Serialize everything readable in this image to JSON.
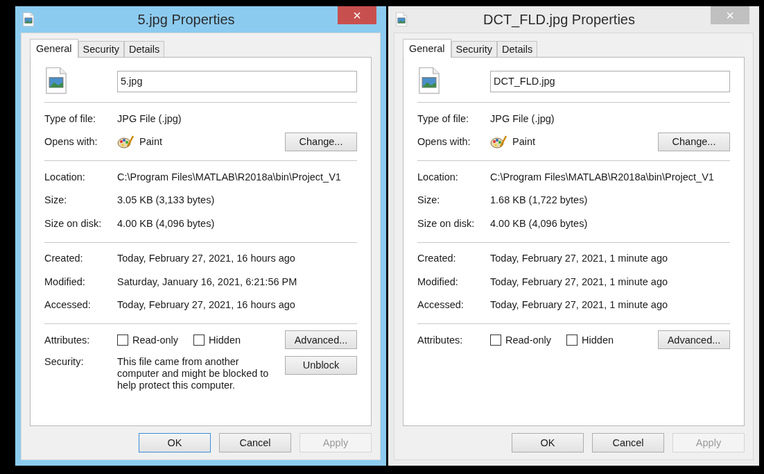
{
  "dialogs": [
    {
      "title": "5.jpg Properties",
      "active": true,
      "close": "×",
      "tabs": [
        {
          "label": "General",
          "selected": true
        },
        {
          "label": "Security",
          "selected": false
        },
        {
          "label": "Details",
          "selected": false
        }
      ],
      "filename": "5.jpg",
      "groups": [
        [
          {
            "kind": "text",
            "label": "Type of file:",
            "value": "JPG File (.jpg)"
          },
          {
            "kind": "app",
            "label": "Opens with:",
            "value": "Paint",
            "button": "Change..."
          }
        ],
        [
          {
            "kind": "text",
            "label": "Location:",
            "value": "C:\\Program Files\\MATLAB\\R2018a\\bin\\Project_V1"
          },
          {
            "kind": "text",
            "label": "Size:",
            "value": "3.05 KB (3,133 bytes)"
          },
          {
            "kind": "text",
            "label": "Size on disk:",
            "value": "4.00 KB (4,096 bytes)"
          }
        ],
        [
          {
            "kind": "text",
            "label": "Created:",
            "value": "Today, February 27, 2021, 16 hours ago"
          },
          {
            "kind": "text",
            "label": "Modified:",
            "value": "Saturday, January 16, 2021, 6:21:56 PM"
          },
          {
            "kind": "text",
            "label": "Accessed:",
            "value": "Today, February 27, 2021, 16 hours ago"
          }
        ],
        [
          {
            "kind": "attributes",
            "label": "Attributes:",
            "options": [
              {
                "label": "Read-only",
                "checked": false
              },
              {
                "label": "Hidden",
                "checked": false
              }
            ],
            "button": "Advanced..."
          },
          {
            "kind": "security",
            "label": "Security:",
            "value": "This file came from another computer and might be blocked to help protect this computer.",
            "button": "Unblock"
          }
        ]
      ],
      "buttons": [
        {
          "label": "OK",
          "default": true,
          "disabled": false
        },
        {
          "label": "Cancel",
          "default": false,
          "disabled": false
        },
        {
          "label": "Apply",
          "default": false,
          "disabled": true
        }
      ]
    },
    {
      "title": "DCT_FLD.jpg Properties",
      "active": false,
      "close": "×",
      "tabs": [
        {
          "label": "General",
          "selected": true
        },
        {
          "label": "Security",
          "selected": false
        },
        {
          "label": "Details",
          "selected": false
        }
      ],
      "filename": "DCT_FLD.jpg",
      "groups": [
        [
          {
            "kind": "text",
            "label": "Type of file:",
            "value": "JPG File (.jpg)"
          },
          {
            "kind": "app",
            "label": "Opens with:",
            "value": "Paint",
            "button": "Change..."
          }
        ],
        [
          {
            "kind": "text",
            "label": "Location:",
            "value": "C:\\Program Files\\MATLAB\\R2018a\\bin\\Project_V1"
          },
          {
            "kind": "text",
            "label": "Size:",
            "value": "1.68 KB (1,722 bytes)"
          },
          {
            "kind": "text",
            "label": "Size on disk:",
            "value": "4.00 KB (4,096 bytes)"
          }
        ],
        [
          {
            "kind": "text",
            "label": "Created:",
            "value": "Today, February 27, 2021, 1 minute ago"
          },
          {
            "kind": "text",
            "label": "Modified:",
            "value": "Today, February 27, 2021, 1 minute ago"
          },
          {
            "kind": "text",
            "label": "Accessed:",
            "value": "Today, February 27, 2021, 1 minute ago"
          }
        ],
        [
          {
            "kind": "attributes",
            "label": "Attributes:",
            "options": [
              {
                "label": "Read-only",
                "checked": false
              },
              {
                "label": "Hidden",
                "checked": false
              }
            ],
            "button": "Advanced..."
          }
        ]
      ],
      "buttons": [
        {
          "label": "OK",
          "default": false,
          "disabled": false
        },
        {
          "label": "Cancel",
          "default": false,
          "disabled": false
        },
        {
          "label": "Apply",
          "default": false,
          "disabled": true
        }
      ]
    }
  ]
}
